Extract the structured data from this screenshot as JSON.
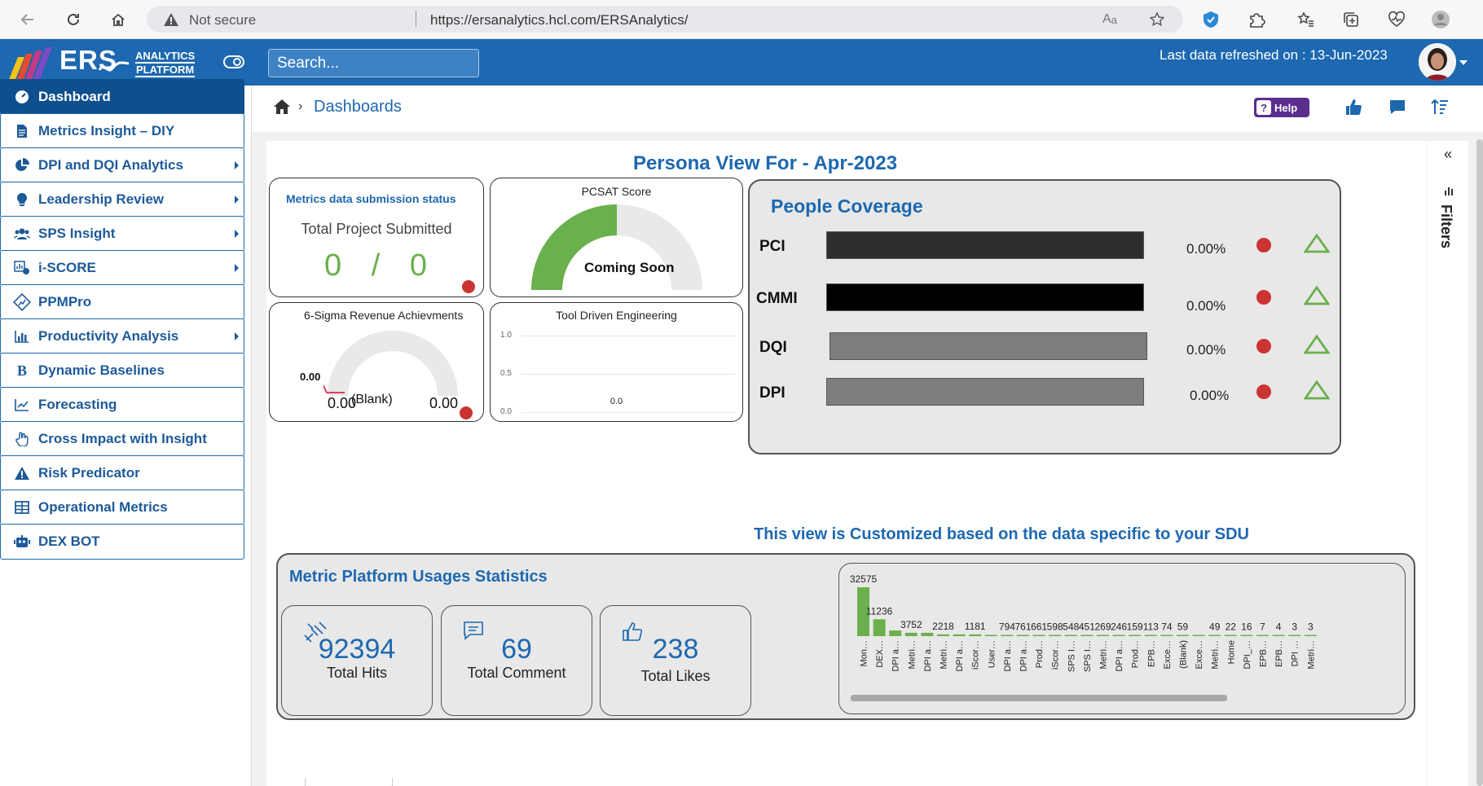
{
  "browser": {
    "security": "Not secure",
    "url": "https://ersanalytics.hcl.com/ERSAnalytics/"
  },
  "header": {
    "logo_ers": "ERS",
    "logo_line1": "ANALYTICS",
    "logo_line2": "PLATFORM",
    "search_placeholder": "Search...",
    "refresh_text": "Last data refreshed on : 13-Jun-2023"
  },
  "sidebar": {
    "items": [
      {
        "label": "Dashboard",
        "icon": "gauge-icon",
        "submenu": false,
        "active": true
      },
      {
        "label": "Metrics Insight – DIY",
        "icon": "document-icon",
        "submenu": false,
        "active": false
      },
      {
        "label": "DPI and DQI Analytics",
        "icon": "pie-chart-icon",
        "submenu": true,
        "active": false
      },
      {
        "label": "Leadership Review",
        "icon": "lightbulb-icon",
        "submenu": true,
        "active": false
      },
      {
        "label": "SPS Insight",
        "icon": "users-icon",
        "submenu": true,
        "active": false
      },
      {
        "label": "i-SCORE",
        "icon": "score-icon",
        "submenu": true,
        "active": false
      },
      {
        "label": "PPMPro",
        "icon": "ppm-icon",
        "submenu": false,
        "active": false
      },
      {
        "label": "Productivity Analysis",
        "icon": "bar-chart-icon",
        "submenu": true,
        "active": false
      },
      {
        "label": "Dynamic Baselines",
        "icon": "letter-b-icon",
        "submenu": false,
        "active": false
      },
      {
        "label": "Forecasting",
        "icon": "line-chart-icon",
        "submenu": false,
        "active": false
      },
      {
        "label": "Cross Impact with Insight",
        "icon": "hand-icon",
        "submenu": false,
        "active": false
      },
      {
        "label": "Risk Predicator",
        "icon": "warning-icon",
        "submenu": false,
        "active": false
      },
      {
        "label": "Operational Metrics",
        "icon": "table-icon",
        "submenu": false,
        "active": false
      },
      {
        "label": "DEX BOT",
        "icon": "robot-icon",
        "submenu": false,
        "active": false
      }
    ]
  },
  "breadcrumb": {
    "current": "Dashboards"
  },
  "toolbar": {
    "help_label": "Help"
  },
  "page": {
    "title": "Persona View For -  Apr-2023",
    "custom_note": "This view is Customized based on the data specific to your SDU"
  },
  "metrics_card": {
    "title": "Metrics data submission status",
    "subtitle": "Total Project Submitted",
    "submitted": "0",
    "slash": "/",
    "total": "0"
  },
  "pcsat_card": {
    "title": "PCSAT Score",
    "status": "Coming Soon",
    "fill_fraction": 0.5
  },
  "sigma_card": {
    "title": "6-Sigma Revenue Achievments",
    "marker": "0.00",
    "min": "0.00",
    "max": "0.00",
    "blank": "(Blank)"
  },
  "tool_card": {
    "title": "Tool Driven Engineering",
    "y_ticks": [
      "1.0",
      "0.5",
      "0.0"
    ],
    "value_label": "0.0"
  },
  "people_coverage": {
    "title": "People Coverage",
    "rows": [
      {
        "label": "PCI",
        "value": "0.00%",
        "bar_color": "#2e2e2e"
      },
      {
        "label": "CMMI",
        "value": "0.00%",
        "bar_color": "#000000"
      },
      {
        "label": "DQI",
        "value": "0.00%",
        "bar_color": "#7d7d7d"
      },
      {
        "label": "DPI",
        "value": "0.00%",
        "bar_color": "#7d7d7d"
      }
    ]
  },
  "usage": {
    "title": "Metric Platform Usages Statistics",
    "stats": [
      {
        "value": "92394",
        "label": "Total Hits",
        "icon": "satellite-icon"
      },
      {
        "value": "69",
        "label": "Total Comment",
        "icon": "comment-icon"
      },
      {
        "value": "238",
        "label": "Total Likes",
        "icon": "like-icon"
      }
    ]
  },
  "filters": {
    "label": "Filters"
  },
  "chart_data": {
    "type": "bar",
    "color": "#6ab04c",
    "categories": [
      "Mon…",
      "DEX…",
      "DPI a…",
      "Metri…",
      "DPI a…",
      "Metri…",
      "DPI a…",
      "iScor…",
      "User…",
      "DPI a…",
      "DPI a…",
      "Prod…",
      "iScor…",
      "SPS I…",
      "SPS I…",
      "Metri…",
      "DPI a…",
      "Prod…",
      "EPB…",
      "Exce…",
      "(Blank)",
      "Exce…",
      "Metri…",
      "Home",
      "DPI_…",
      "EPB…",
      "EPB…",
      "DPI …",
      "Metri…"
    ],
    "values": [
      32575,
      11236,
      3752,
      2218,
      2218,
      1181,
      1181,
      1181,
      794,
      761,
      661,
      598,
      548,
      451,
      269,
      246,
      159,
      113,
      74,
      59,
      59,
      49,
      22,
      16,
      7,
      7,
      4,
      3,
      3
    ],
    "data_labels": [
      "32575",
      "11236",
      "",
      "3752",
      "",
      "2218",
      "",
      "1181",
      "",
      "794",
      "761",
      "661",
      "598",
      "548",
      "451",
      "269",
      "246",
      "159",
      "113",
      "74",
      "59",
      "",
      "49",
      "22",
      "16",
      "7",
      "4",
      "3",
      "3"
    ]
  }
}
